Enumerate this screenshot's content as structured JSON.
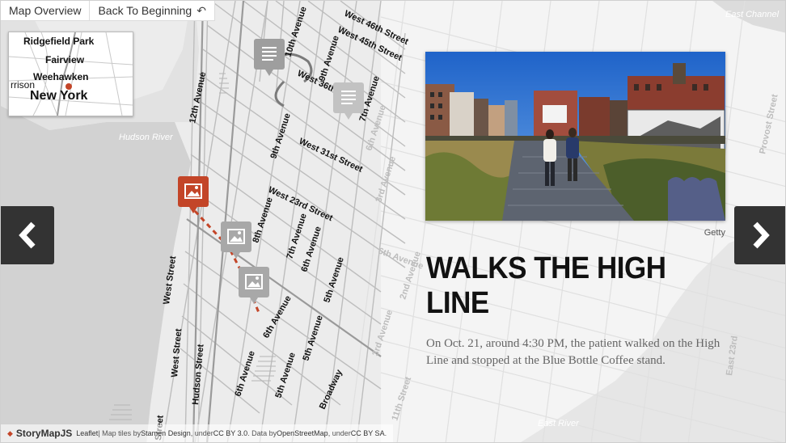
{
  "topbar": {
    "overview_label": "Map Overview",
    "back_label": "Back To Beginning"
  },
  "minimap": {
    "labels": [
      "Ridgefield Park",
      "Fairview",
      "Weehawken",
      "rrison",
      "New York"
    ]
  },
  "map": {
    "streets": [
      "West 46th Street",
      "West 45th Street",
      "West 36th Street",
      "West 31st Street",
      "West 23rd Street",
      "10th Avenue",
      "9th Avenue",
      "12th Avenue",
      "9th Avenue",
      "7th Avenue",
      "8th Avenue",
      "7th Avenue",
      "6th Avenue",
      "5th Avenue",
      "6th Avenue",
      "5th Avenue",
      "6th Avenue",
      "5th Avenue",
      "Broadway",
      "West Street",
      "West Street",
      "Hudson Street",
      "Street",
      "3rd Avenue",
      "3rd Avenue",
      "2nd Avenue",
      "11th Street",
      "Provost Street",
      "East 23rd",
      "6th Avenue"
    ],
    "water": [
      "Hudson River",
      "East Channel",
      "East River"
    ]
  },
  "slide": {
    "credit": "Getty",
    "headline": "WALKS THE HIGH LINE",
    "text": "On Oct. 21, around 4:30 PM, the patient walked on the High Line and stopped at the Blue Bottle Coffee stand."
  },
  "attribution": {
    "brand": "StoryMapJS",
    "leaflet": "Leaflet",
    "text1": " | Map tiles by ",
    "stamen": "Stamen Design",
    "text2": ", under ",
    "ccby": "CC BY 3.0",
    "text3": ". Data by ",
    "osm": "OpenStreetMap",
    "text4": ", under ",
    "ccbysa": "CC BY SA",
    "text5": "."
  },
  "colors": {
    "marker_active": "#c34528",
    "marker_inactive": "#9e9e9e",
    "route": "#c34528",
    "nav_bg": "#333333"
  },
  "icons": {
    "prev": "chevron-left-icon",
    "next": "chevron-right-icon",
    "back": "undo-arrow-icon",
    "marker": "image-icon",
    "marker_text": "document-icon"
  }
}
